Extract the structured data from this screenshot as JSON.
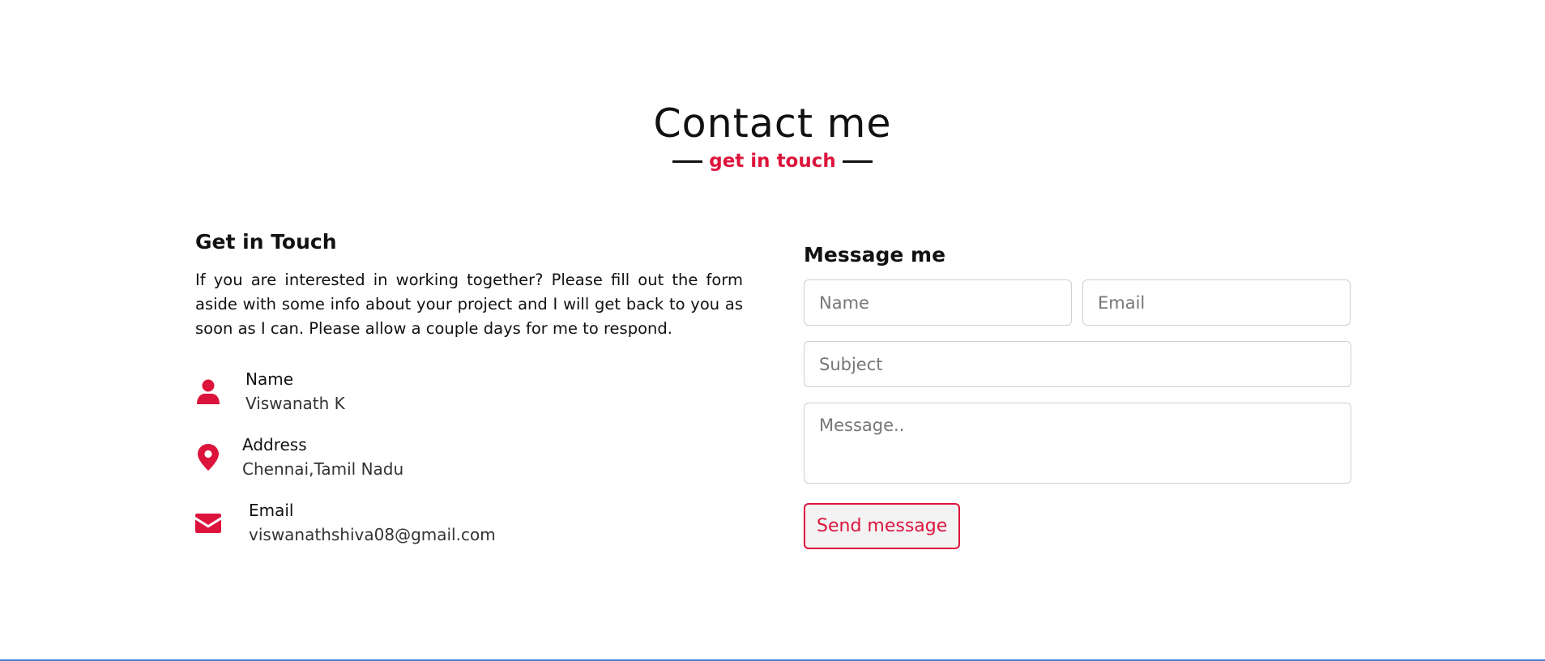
{
  "header": {
    "title": "Contact me",
    "subtitle": "get in touch"
  },
  "left": {
    "heading": "Get in Touch",
    "description": "If you are interested in working together? Please fill out the form aside with some info about your project and I will get back to you as soon as I can. Please allow a couple days for me to respond.",
    "items": [
      {
        "icon": "user-icon",
        "label": "Name",
        "value": "Viswanath K"
      },
      {
        "icon": "map-pin-icon",
        "label": "Address",
        "value": "Chennai,Tamil Nadu"
      },
      {
        "icon": "envelope-icon",
        "label": "Email",
        "value": "viswanathshiva08@gmail.com"
      }
    ]
  },
  "form": {
    "heading": "Message me",
    "name_placeholder": "Name",
    "email_placeholder": "Email",
    "subject_placeholder": "Subject",
    "message_placeholder": "Message..",
    "send_label": "Send message"
  },
  "colors": {
    "accent": "#dc143c",
    "text": "#111111",
    "border": "#cfcfcf",
    "bottom_line": "#4a7bd6"
  }
}
